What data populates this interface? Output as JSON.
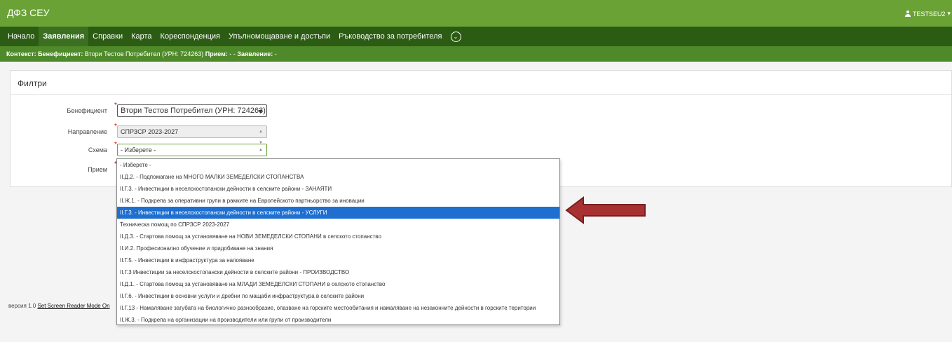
{
  "app": {
    "title": "ДФЗ СЕУ",
    "user": "TESTSEU2"
  },
  "nav": {
    "items": [
      {
        "label": "Начало",
        "active": false
      },
      {
        "label": "Заявления",
        "active": true
      },
      {
        "label": "Справки",
        "active": false
      },
      {
        "label": "Карта",
        "active": false
      },
      {
        "label": "Кореспонденция",
        "active": false
      },
      {
        "label": "Упълномощаване и достъпи",
        "active": false
      },
      {
        "label": "Ръководство за потребителя",
        "active": false
      }
    ]
  },
  "context": {
    "prefix": "Контекст:",
    "beneficiary_label": "Бенефициент:",
    "beneficiary_value": "Втори Тестов Потребител (УРН: 724263)",
    "intake_label": "Прием:",
    "intake_value": "-",
    "application_label": "Заявление:",
    "application_value": "-"
  },
  "filters": {
    "title": "Филтри",
    "beneficiary": {
      "label": "Бенефициент",
      "value": "Втори Тестов Потребител (УРН: 724263)"
    },
    "direction": {
      "label": "Направление",
      "value": "СПРЗСР 2023-2027"
    },
    "scheme": {
      "label": "Схема",
      "value": "- Изберете -"
    },
    "intake": {
      "label": "Прием"
    }
  },
  "scheme_options": [
    "- Изберете -",
    "II.Д.2. - Подпомагане на МНОГО МАЛКИ ЗЕМЕДЕЛСКИ СТОПАНСТВА",
    "II.Г.3. - Инвестиции в неселскостопански дейности в селските райони - ЗАНАЯТИ",
    "II.Ж.1. - Подкрепа за оперативни групи в рамките на Европейското партньорство за иновации",
    "II.Г.3. - Инвестиции в неселскостопански дейности в селските райони - УСЛУГИ",
    "Техническа помощ по СПРЗСР 2023-2027",
    "II.Д.3. - Стартова помощ за установяване на НОВИ ЗЕМЕДЕЛСКИ СТОПАНИ в селското стопанство",
    "II.И.2. Професионално обучение и придобиване на знания",
    "II.Г.5. - Инвестиции в инфраструктура за напояване",
    "II.Г.3 Инвестиции за неселскостопански дейности в селските райони - ПРОИЗВОДСТВО",
    "II.Д.1. - Стартова помощ за установяване на МЛАДИ ЗЕМЕДЕЛСКИ СТОПАНИ в селското стопанство",
    "II.Г.6. - Инвестиции в основни услуги и дребни по мащаби инфраструктура в селските райони",
    "II.Г.13 - Намаляване загубата на биологично разнообразие, опазване на горските местообитания и намаляване на незаконните дейности в горските територии",
    "II.Ж.3. - Подкрепа на организации на производители или групи от производители"
  ],
  "selected_option_index": 4,
  "footer": {
    "version": "версия 1.0",
    "reader_link": "Set Screen Reader Mode On"
  },
  "colors": {
    "header": "#6aa236",
    "nav": "#2c5b14",
    "context": "#4f8a2a",
    "selected": "#1e6fd0",
    "arrow": "#a83232"
  }
}
